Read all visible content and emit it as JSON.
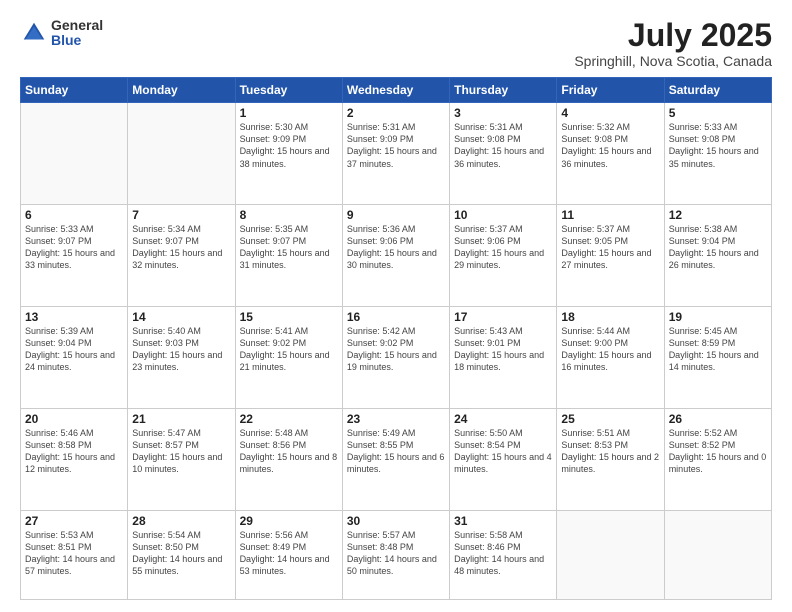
{
  "logo": {
    "general": "General",
    "blue": "Blue"
  },
  "header": {
    "title": "July 2025",
    "subtitle": "Springhill, Nova Scotia, Canada"
  },
  "days_of_week": [
    "Sunday",
    "Monday",
    "Tuesday",
    "Wednesday",
    "Thursday",
    "Friday",
    "Saturday"
  ],
  "weeks": [
    [
      {
        "day": "",
        "sunrise": "",
        "sunset": "",
        "daylight": ""
      },
      {
        "day": "",
        "sunrise": "",
        "sunset": "",
        "daylight": ""
      },
      {
        "day": "1",
        "sunrise": "Sunrise: 5:30 AM",
        "sunset": "Sunset: 9:09 PM",
        "daylight": "Daylight: 15 hours and 38 minutes."
      },
      {
        "day": "2",
        "sunrise": "Sunrise: 5:31 AM",
        "sunset": "Sunset: 9:09 PM",
        "daylight": "Daylight: 15 hours and 37 minutes."
      },
      {
        "day": "3",
        "sunrise": "Sunrise: 5:31 AM",
        "sunset": "Sunset: 9:08 PM",
        "daylight": "Daylight: 15 hours and 36 minutes."
      },
      {
        "day": "4",
        "sunrise": "Sunrise: 5:32 AM",
        "sunset": "Sunset: 9:08 PM",
        "daylight": "Daylight: 15 hours and 36 minutes."
      },
      {
        "day": "5",
        "sunrise": "Sunrise: 5:33 AM",
        "sunset": "Sunset: 9:08 PM",
        "daylight": "Daylight: 15 hours and 35 minutes."
      }
    ],
    [
      {
        "day": "6",
        "sunrise": "Sunrise: 5:33 AM",
        "sunset": "Sunset: 9:07 PM",
        "daylight": "Daylight: 15 hours and 33 minutes."
      },
      {
        "day": "7",
        "sunrise": "Sunrise: 5:34 AM",
        "sunset": "Sunset: 9:07 PM",
        "daylight": "Daylight: 15 hours and 32 minutes."
      },
      {
        "day": "8",
        "sunrise": "Sunrise: 5:35 AM",
        "sunset": "Sunset: 9:07 PM",
        "daylight": "Daylight: 15 hours and 31 minutes."
      },
      {
        "day": "9",
        "sunrise": "Sunrise: 5:36 AM",
        "sunset": "Sunset: 9:06 PM",
        "daylight": "Daylight: 15 hours and 30 minutes."
      },
      {
        "day": "10",
        "sunrise": "Sunrise: 5:37 AM",
        "sunset": "Sunset: 9:06 PM",
        "daylight": "Daylight: 15 hours and 29 minutes."
      },
      {
        "day": "11",
        "sunrise": "Sunrise: 5:37 AM",
        "sunset": "Sunset: 9:05 PM",
        "daylight": "Daylight: 15 hours and 27 minutes."
      },
      {
        "day": "12",
        "sunrise": "Sunrise: 5:38 AM",
        "sunset": "Sunset: 9:04 PM",
        "daylight": "Daylight: 15 hours and 26 minutes."
      }
    ],
    [
      {
        "day": "13",
        "sunrise": "Sunrise: 5:39 AM",
        "sunset": "Sunset: 9:04 PM",
        "daylight": "Daylight: 15 hours and 24 minutes."
      },
      {
        "day": "14",
        "sunrise": "Sunrise: 5:40 AM",
        "sunset": "Sunset: 9:03 PM",
        "daylight": "Daylight: 15 hours and 23 minutes."
      },
      {
        "day": "15",
        "sunrise": "Sunrise: 5:41 AM",
        "sunset": "Sunset: 9:02 PM",
        "daylight": "Daylight: 15 hours and 21 minutes."
      },
      {
        "day": "16",
        "sunrise": "Sunrise: 5:42 AM",
        "sunset": "Sunset: 9:02 PM",
        "daylight": "Daylight: 15 hours and 19 minutes."
      },
      {
        "day": "17",
        "sunrise": "Sunrise: 5:43 AM",
        "sunset": "Sunset: 9:01 PM",
        "daylight": "Daylight: 15 hours and 18 minutes."
      },
      {
        "day": "18",
        "sunrise": "Sunrise: 5:44 AM",
        "sunset": "Sunset: 9:00 PM",
        "daylight": "Daylight: 15 hours and 16 minutes."
      },
      {
        "day": "19",
        "sunrise": "Sunrise: 5:45 AM",
        "sunset": "Sunset: 8:59 PM",
        "daylight": "Daylight: 15 hours and 14 minutes."
      }
    ],
    [
      {
        "day": "20",
        "sunrise": "Sunrise: 5:46 AM",
        "sunset": "Sunset: 8:58 PM",
        "daylight": "Daylight: 15 hours and 12 minutes."
      },
      {
        "day": "21",
        "sunrise": "Sunrise: 5:47 AM",
        "sunset": "Sunset: 8:57 PM",
        "daylight": "Daylight: 15 hours and 10 minutes."
      },
      {
        "day": "22",
        "sunrise": "Sunrise: 5:48 AM",
        "sunset": "Sunset: 8:56 PM",
        "daylight": "Daylight: 15 hours and 8 minutes."
      },
      {
        "day": "23",
        "sunrise": "Sunrise: 5:49 AM",
        "sunset": "Sunset: 8:55 PM",
        "daylight": "Daylight: 15 hours and 6 minutes."
      },
      {
        "day": "24",
        "sunrise": "Sunrise: 5:50 AM",
        "sunset": "Sunset: 8:54 PM",
        "daylight": "Daylight: 15 hours and 4 minutes."
      },
      {
        "day": "25",
        "sunrise": "Sunrise: 5:51 AM",
        "sunset": "Sunset: 8:53 PM",
        "daylight": "Daylight: 15 hours and 2 minutes."
      },
      {
        "day": "26",
        "sunrise": "Sunrise: 5:52 AM",
        "sunset": "Sunset: 8:52 PM",
        "daylight": "Daylight: 15 hours and 0 minutes."
      }
    ],
    [
      {
        "day": "27",
        "sunrise": "Sunrise: 5:53 AM",
        "sunset": "Sunset: 8:51 PM",
        "daylight": "Daylight: 14 hours and 57 minutes."
      },
      {
        "day": "28",
        "sunrise": "Sunrise: 5:54 AM",
        "sunset": "Sunset: 8:50 PM",
        "daylight": "Daylight: 14 hours and 55 minutes."
      },
      {
        "day": "29",
        "sunrise": "Sunrise: 5:56 AM",
        "sunset": "Sunset: 8:49 PM",
        "daylight": "Daylight: 14 hours and 53 minutes."
      },
      {
        "day": "30",
        "sunrise": "Sunrise: 5:57 AM",
        "sunset": "Sunset: 8:48 PM",
        "daylight": "Daylight: 14 hours and 50 minutes."
      },
      {
        "day": "31",
        "sunrise": "Sunrise: 5:58 AM",
        "sunset": "Sunset: 8:46 PM",
        "daylight": "Daylight: 14 hours and 48 minutes."
      },
      {
        "day": "",
        "sunrise": "",
        "sunset": "",
        "daylight": ""
      },
      {
        "day": "",
        "sunrise": "",
        "sunset": "",
        "daylight": ""
      }
    ]
  ]
}
